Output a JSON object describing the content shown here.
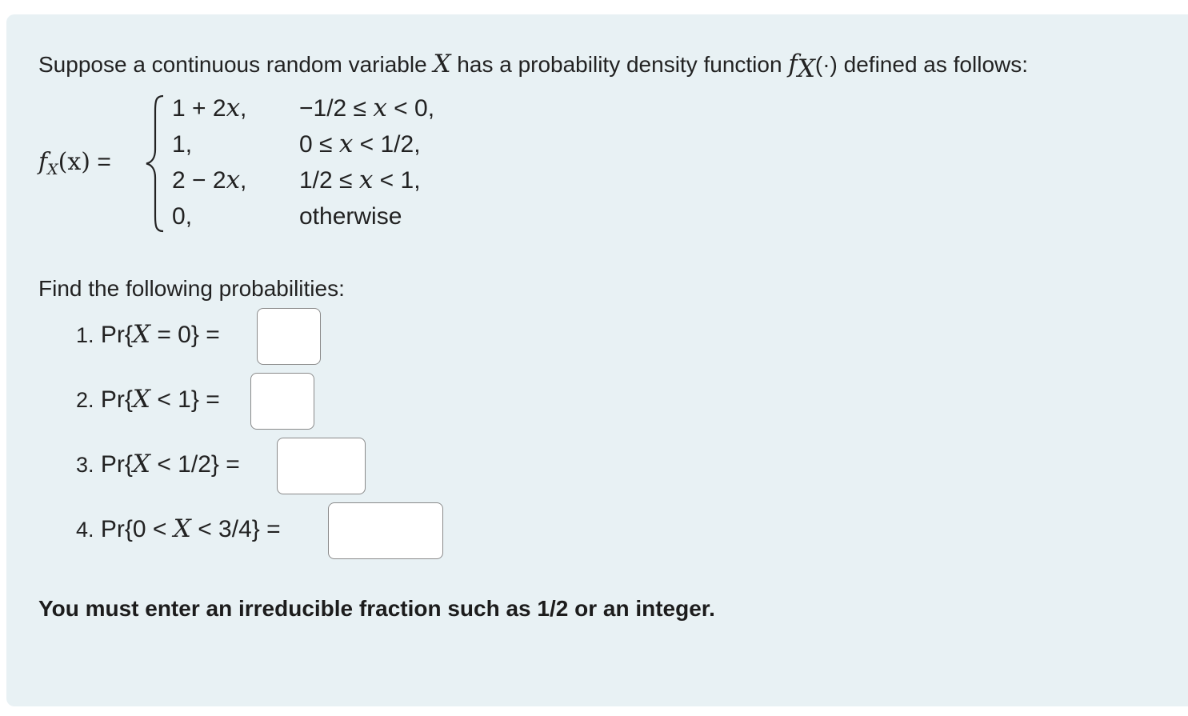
{
  "intro": {
    "text_before": "Suppose a continuous random variable",
    "var": "X",
    "text_middle": "has a probability density function",
    "func": "f",
    "func_sub": "X",
    "func_arg": "(·)",
    "text_after": "defined as follows:"
  },
  "pdf": {
    "lhs_func": "f",
    "lhs_sub": "X",
    "lhs_arg": "(x)",
    "lhs_eq": "=",
    "cases": [
      {
        "expr_pre": "1 + 2",
        "expr_var": "x",
        "expr_post": ",",
        "cond_pre": "−1/2 ≤ ",
        "cond_var": "x",
        "cond_post": " < 0,"
      },
      {
        "expr_pre": "1",
        "expr_var": "",
        "expr_post": ",",
        "cond_pre": "0 ≤ ",
        "cond_var": "x",
        "cond_post": " < 1/2,"
      },
      {
        "expr_pre": "2 − 2",
        "expr_var": "x",
        "expr_post": ",",
        "cond_pre": "1/2 ≤ ",
        "cond_var": "x",
        "cond_post": " < 1,"
      },
      {
        "expr_pre": "0",
        "expr_var": "",
        "expr_post": ",",
        "cond_pre": "otherwise",
        "cond_var": "",
        "cond_post": ""
      }
    ]
  },
  "find_label": "Find the following probabilities:",
  "questions": [
    {
      "num": "1.",
      "pre": "Pr{",
      "var": "X",
      "post": " = 0}",
      "eq": "=",
      "value": ""
    },
    {
      "num": "2.",
      "pre": "Pr{",
      "var": "X",
      "post": " < 1}",
      "eq": "=",
      "value": ""
    },
    {
      "num": "3.",
      "pre": "Pr{",
      "var": "X",
      "post": " < 1/2}",
      "eq": "=",
      "value": ""
    },
    {
      "num": "4.",
      "pre": "Pr{0 < ",
      "var": "X",
      "post": " < 3/4}",
      "eq": "=",
      "value": ""
    }
  ],
  "note": "You must enter an irreducible fraction such as 1/2 or an integer."
}
